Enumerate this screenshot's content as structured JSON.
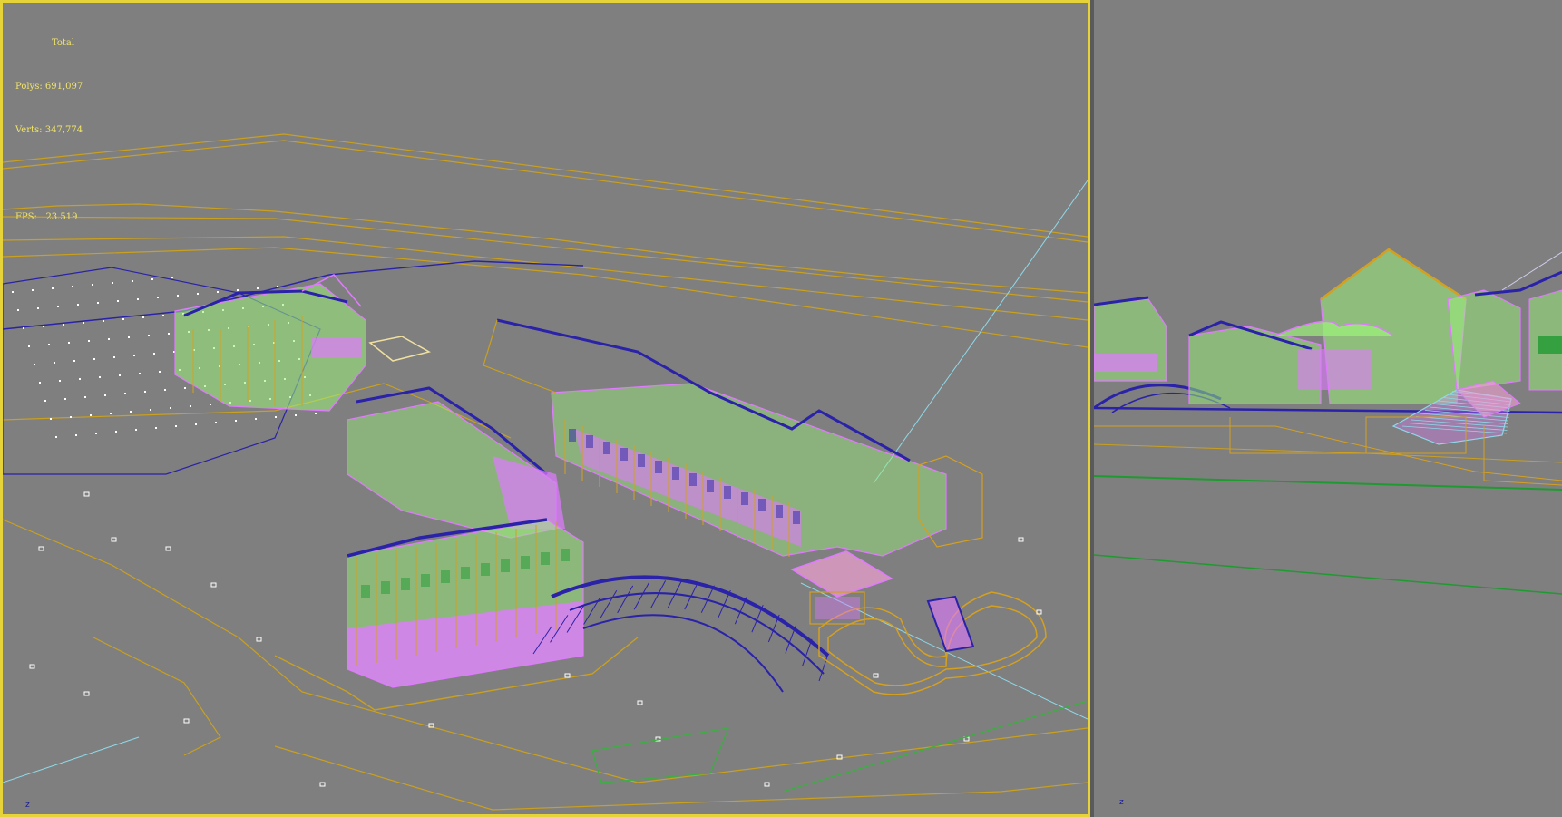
{
  "viewport_left": {
    "stats": {
      "total_label": "Total",
      "polys_label": "Polys:",
      "polys_value": "691,097",
      "verts_label": "Verts:",
      "verts_value": "347,774",
      "fps_label": "FPS:",
      "fps_value": "23.519"
    },
    "axis_label": "z",
    "active": true
  },
  "viewport_right": {
    "axis_label": "z",
    "active": false
  },
  "colors": {
    "background": "#7f7f7f",
    "active_border": "#e6d33a",
    "stats_text": "#f0e46a",
    "wire_yellow": "#d4a020",
    "wire_green": "#9cf27a",
    "wire_magenta": "#e07aff",
    "wire_blue": "#2a22a8",
    "wire_cyan": "#8fd8e8"
  }
}
